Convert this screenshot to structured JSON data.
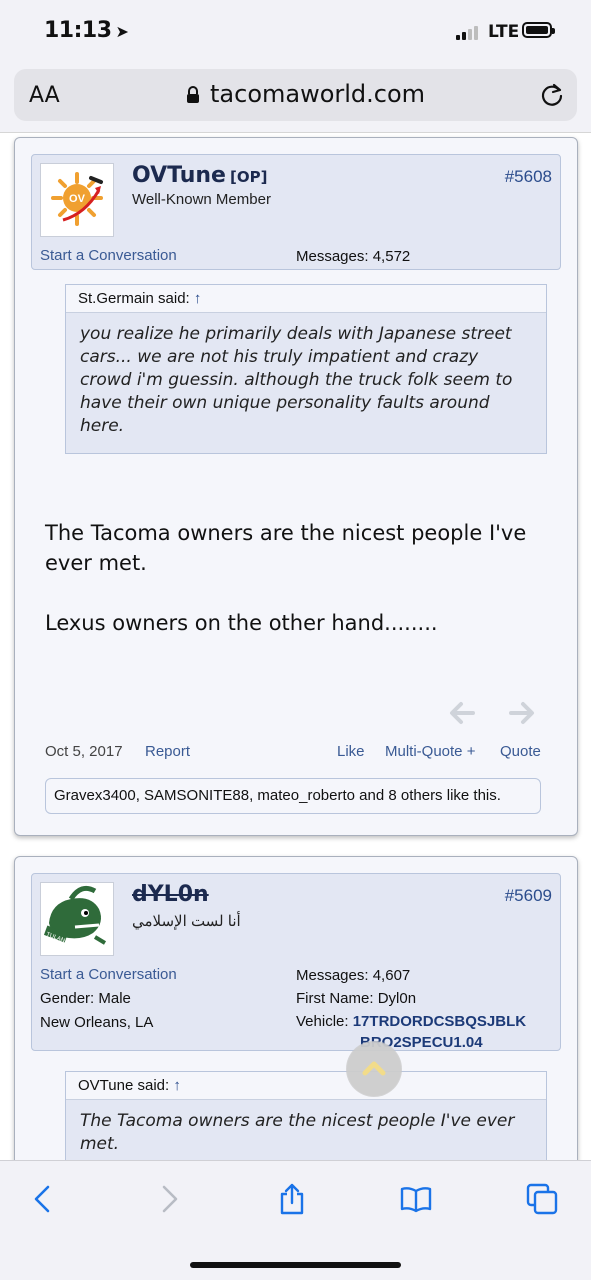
{
  "status_bar": {
    "time": "11:13",
    "network": "LTE"
  },
  "browser": {
    "text_size_label": "AA",
    "domain": "tacomaworld.com"
  },
  "posts": [
    {
      "username": "OVTune",
      "op_tag": "[OP]",
      "user_title": "Well-Known Member",
      "post_number": "#5608",
      "start_conversation": "Start a Conversation",
      "messages_label": "Messages:",
      "messages_value": "4,572",
      "quote_author": "St.Germain said:",
      "quote_up": "↑",
      "quote_text": "you realize he primarily deals with Japanese street cars... we are not his truly impatient and crazy crowd i'm guessin. although the truck folk seem to have their own unique personality faults around here.",
      "message_p1": "The Tacoma owners are the nicest people I've ever met.",
      "message_p2": "Lexus owners on the other hand........",
      "date": "Oct 5, 2017",
      "report": "Report",
      "like": "Like",
      "multi_quote": "Multi-Quote +",
      "quote_btn": "Quote",
      "likes_users": "Gravex3400, SAMSONITE88, mateo_roberto",
      "likes_and": "and",
      "likes_others": "8 others",
      "likes_suffix": "like this."
    },
    {
      "username": "dYL0n",
      "user_title": "أنا لست الإسلامي",
      "post_number": "#5609",
      "start_conversation": "Start a Conversation",
      "gender_label": "Gender:",
      "gender_value": "Male",
      "location": "New Orleans, LA",
      "messages_label": "Messages:",
      "messages_value": "4,607",
      "first_name_label": "First Name:",
      "first_name_value": "Dyl0n",
      "vehicle_label": "Vehicle:",
      "vehicle_line1": "17TRDORDCSBQSJBLK",
      "vehicle_line2": "BRO2SPECU1.04",
      "quote_author": "OVTune said:",
      "quote_up": "↑",
      "quote_text": "The Tacoma owners are the nicest people I've ever met."
    }
  ],
  "colors": {
    "link": "#3a5a94",
    "userbox": "#e3e7f3",
    "post_bg": "#f5f6fb",
    "accent_blue": "#1a73e8"
  },
  "icons": [
    "location-arrow-icon",
    "signal-icon",
    "battery-icon",
    "lock-icon",
    "reload-icon",
    "back-icon",
    "forward-icon",
    "share-icon",
    "bookmarks-icon",
    "tabs-icon",
    "scroll-top-icon",
    "prev-post-icon",
    "next-post-icon"
  ]
}
